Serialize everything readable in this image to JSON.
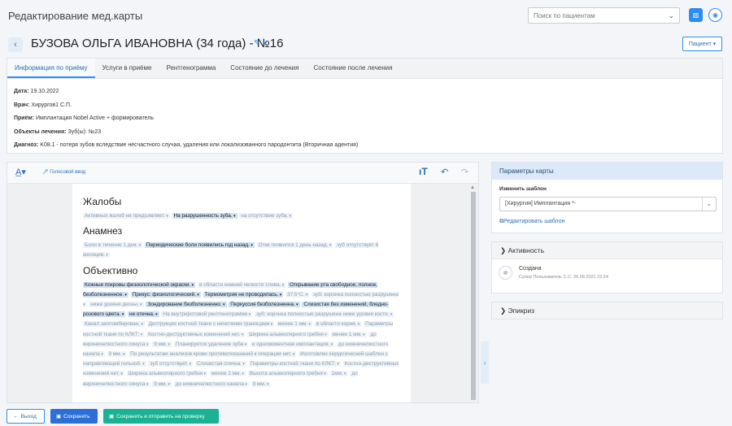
{
  "app": {
    "title": "Редактирование мед.карты"
  },
  "search": {
    "placeholder": "Поиск по пациентам"
  },
  "icons": {
    "grid": "grid-icon",
    "info": "info-icon",
    "back": "chevron-left-icon",
    "edit": "pencil-icon"
  },
  "patient": {
    "title": "БУЗОВА ОЛЬГА ИВАНОВНА (34 года) - №16",
    "button_label": "Пациент ▾"
  },
  "tabs": [
    {
      "label": "Информация по приёму",
      "active": true
    },
    {
      "label": "Услуги в приёме"
    },
    {
      "label": "Рентгенограмма"
    },
    {
      "label": "Состояние до лечения"
    },
    {
      "label": "Состояние после лечения"
    }
  ],
  "visit": {
    "date_label": "Дата:",
    "date_value": "19.10.2022",
    "doctor_label": "Врач:",
    "doctor_value": "Хирургов1 С.П.",
    "reception_label": "Приём:",
    "reception_value": "Имплантация Nobel Active + формирователь",
    "objects_label": "Объекты лечения:",
    "objects_value": "Зуб(ы): №23",
    "diagnosis_label": "Диагноз:",
    "diagnosis_value": "K08.1 - потеря зубов вследствие несчастного случая, удаления или локализованного пародонтита (Вторичная адентия)"
  },
  "editor": {
    "voice_label": "Голосовой ввод",
    "sections": [
      {
        "heading": "Жалобы",
        "tags": [
          {
            "text": "Активных жалоб не предъявляет.",
            "sel": false
          },
          {
            "text": "На разрушенность зуба.",
            "sel": true
          },
          {
            "text": "на отсутствие зуба.",
            "sel": false
          }
        ]
      },
      {
        "heading": "Анамнез",
        "tags": [
          {
            "text": "Боли в течение 1 дня.",
            "sel": false
          },
          {
            "text": "Периодические боли появились год назад.",
            "sel": true
          },
          {
            "text": "Отек появился 1 день назад.",
            "sel": false
          },
          {
            "text": "зуб отсутствует 6 месяцев.",
            "sel": false
          }
        ]
      },
      {
        "heading": "Объективно",
        "tags": [
          {
            "text": "Кожные покровы физиологической окраски.",
            "sel": true
          },
          {
            "text": "в области нижней челюсти слева.",
            "sel": false
          },
          {
            "text": "Открывание рта свободное, полное, безболезненное.",
            "sel": true
          },
          {
            "text": "Прикус: физиологический.",
            "sel": true
          },
          {
            "text": "Термометрия не проводилась.",
            "sel": true
          },
          {
            "text": "37,5°С.",
            "sel": false
          },
          {
            "text": "зуб: коронка полностью разрушена",
            "sel": false
          },
          {
            "text": "ниже уровня десны.",
            "sel": false
          },
          {
            "text": "Зондирование безболезненно.",
            "sel": true
          },
          {
            "text": "Перкуссия безболезненна.",
            "sel": true
          },
          {
            "text": "Слизистая без изменений, бледно-розового цвета.",
            "sel": true
          },
          {
            "text": "не отечна.",
            "sel": true
          },
          {
            "text": "На внутриротовой рентгенограмме",
            "sel": false
          },
          {
            "text": "зуб: коронка полностью разрушена ниже уровня кости.",
            "sel": false
          },
          {
            "text": "Канал запломбирован.",
            "sel": false
          },
          {
            "text": "Деструкция костной ткани с нечеткими границами",
            "sel": false
          },
          {
            "text": "менее 1 мм.",
            "sel": false
          },
          {
            "text": "в области корня.",
            "sel": false
          },
          {
            "text": "Параметры костной ткани по КЛКТ:",
            "sel": false
          },
          {
            "text": "Костно-деструктивных изменений нет.",
            "sel": false
          },
          {
            "text": "Ширина альвеолярного гребня",
            "sel": false
          },
          {
            "text": "менее 1 мм.",
            "sel": false
          },
          {
            "text": "до верхнечелюстного синуса",
            "sel": false
          },
          {
            "text": "9 мм.",
            "sel": false
          },
          {
            "text": "Планируется удаление зуба",
            "sel": false
          },
          {
            "text": "и одномоментная имплантация.",
            "sel": false
          },
          {
            "text": "до нижнечелюстного канала",
            "sel": false
          },
          {
            "text": "9 мм.",
            "sel": false
          },
          {
            "text": "По результатам анализов крови противопоказаний к операции нет.",
            "sel": false
          },
          {
            "text": "Изготовлен хирургический шаблон с направляющей гильзой.",
            "sel": false
          },
          {
            "text": "зуб отсутствует.",
            "sel": false
          },
          {
            "text": "Слизистая отечна.",
            "sel": false
          },
          {
            "text": "Параметры костной ткани по КЛКТ:",
            "sel": false
          },
          {
            "text": "Костно-деструктивных изменений нет.",
            "sel": false
          },
          {
            "text": "Ширина альвеолярного гребня",
            "sel": false
          },
          {
            "text": "менее 1 мм.",
            "sel": false
          },
          {
            "text": "Высота альвеолярного гребня",
            "sel": false
          },
          {
            "text": "1мм.",
            "sel": false
          },
          {
            "text": "до верхнечелюстного синуса",
            "sel": false
          },
          {
            "text": "9 мм.",
            "sel": false
          },
          {
            "text": "до нижнечелюстного канала",
            "sel": false
          },
          {
            "text": "9 мм.",
            "sel": false
          }
        ]
      }
    ]
  },
  "params_card": {
    "title": "Параметры карты",
    "template_label": "Изменить шаблон",
    "template_value": "[Хирургия] Имплантация *-",
    "edit_template_link": "Редактировать шаблон"
  },
  "activity_card": {
    "title": "Активность",
    "event_title": "Создана",
    "event_sub": "Супер Пользователь С.С. 26.09.2021 22:24"
  },
  "epicrisis_card": {
    "title": "Эпикриз"
  },
  "footer": {
    "exit_label": "Выход",
    "save_label": "Сохранить",
    "send_label": "Сохранить и отправить на проверку"
  }
}
